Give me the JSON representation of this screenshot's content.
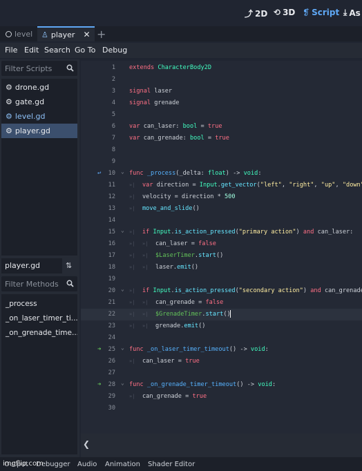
{
  "workspaces": [
    {
      "label": "2D",
      "icon": "2d-icon",
      "active": false
    },
    {
      "label": "3D",
      "icon": "3d-icon",
      "active": false
    },
    {
      "label": "Script",
      "icon": "script-icon",
      "active": true
    },
    {
      "label": "As",
      "icon": "assetlib-icon",
      "active": false
    }
  ],
  "tabs": [
    {
      "label": "level",
      "icon": "node-icon",
      "active": false
    },
    {
      "label": "player",
      "icon": "character-icon",
      "active": true
    }
  ],
  "add_tab_label": "+",
  "menu": [
    "File",
    "Edit",
    "Search",
    "Go To",
    "Debug"
  ],
  "scripts_filter_placeholder": "Filter Scripts",
  "scripts": [
    {
      "name": "drone.gd",
      "selected": false
    },
    {
      "name": "gate.gd",
      "selected": false
    },
    {
      "name": "level.gd",
      "selected": false
    },
    {
      "name": "player.gd",
      "selected": true
    }
  ],
  "current_script": "player.gd",
  "methods_filter_placeholder": "Filter Methods",
  "methods": [
    "_process",
    "_on_laser_timer_ti...",
    "_on_grenade_time..."
  ],
  "code_lines": [
    {
      "n": "1",
      "t": [
        [
          "kw",
          "extends "
        ],
        [
          "ty",
          "CharacterBody2D"
        ]
      ]
    },
    {
      "n": "2",
      "t": []
    },
    {
      "n": "3",
      "t": [
        [
          "kw",
          "signal "
        ],
        [
          "tx",
          "laser"
        ]
      ]
    },
    {
      "n": "4",
      "t": [
        [
          "kw",
          "signal "
        ],
        [
          "tx",
          "grenade"
        ]
      ]
    },
    {
      "n": "5",
      "t": []
    },
    {
      "n": "6",
      "t": [
        [
          "kw",
          "var "
        ],
        [
          "tx",
          "can_laser: "
        ],
        [
          "ty",
          "bool"
        ],
        [
          "tx",
          " = "
        ],
        [
          "kw",
          "true"
        ]
      ]
    },
    {
      "n": "7",
      "t": [
        [
          "kw",
          "var "
        ],
        [
          "tx",
          "can_grenade: "
        ],
        [
          "ty",
          "bool"
        ],
        [
          "tx",
          " = "
        ],
        [
          "kw",
          "true"
        ]
      ]
    },
    {
      "n": "8",
      "t": []
    },
    {
      "n": "9",
      "t": []
    },
    {
      "n": "10",
      "t": [
        [
          "kw",
          "func "
        ],
        [
          "fn",
          "_process"
        ],
        [
          "tx",
          "(_delta: "
        ],
        [
          "ty",
          "float"
        ],
        [
          "tx",
          ") -> "
        ],
        [
          "ty",
          "void"
        ],
        [
          "tx",
          ":"
        ]
      ],
      "fold": true,
      "gutter": "override"
    },
    {
      "n": "11",
      "t": [
        [
          "kw",
          "var "
        ],
        [
          "tx",
          "direction = "
        ],
        [
          "ty",
          "Input"
        ],
        [
          "tx",
          "."
        ],
        [
          "fc",
          "get_vector"
        ],
        [
          "tx",
          "("
        ],
        [
          "st",
          "\"left\""
        ],
        [
          "tx",
          ", "
        ],
        [
          "st",
          "\"right\""
        ],
        [
          "tx",
          ", "
        ],
        [
          "st",
          "\"up\""
        ],
        [
          "tx",
          ", "
        ],
        [
          "st",
          "\"down\""
        ],
        [
          "tx",
          ")"
        ]
      ],
      "indent": 1
    },
    {
      "n": "12",
      "t": [
        [
          "tx",
          "velocity = direction * "
        ],
        [
          "nm",
          "500"
        ]
      ],
      "indent": 1
    },
    {
      "n": "13",
      "t": [
        [
          "fc",
          "move_and_slide"
        ],
        [
          "tx",
          "()"
        ]
      ],
      "indent": 1
    },
    {
      "n": "14",
      "t": []
    },
    {
      "n": "15",
      "t": [
        [
          "kw",
          "if "
        ],
        [
          "ty",
          "Input"
        ],
        [
          "tx",
          "."
        ],
        [
          "fc",
          "is_action_pressed"
        ],
        [
          "tx",
          "("
        ],
        [
          "st",
          "\"primary action\""
        ],
        [
          "tx",
          ") "
        ],
        [
          "kw",
          "and "
        ],
        [
          "tx",
          "can_laser:"
        ]
      ],
      "indent": 1,
      "fold": true
    },
    {
      "n": "16",
      "t": [
        [
          "tx",
          "can_laser = "
        ],
        [
          "kw",
          "false"
        ]
      ],
      "indent": 2
    },
    {
      "n": "17",
      "t": [
        [
          "nd",
          "$LaserTimer"
        ],
        [
          "tx",
          "."
        ],
        [
          "fc",
          "start"
        ],
        [
          "tx",
          "()"
        ]
      ],
      "indent": 2
    },
    {
      "n": "18",
      "t": [
        [
          "tx",
          "laser."
        ],
        [
          "fc",
          "emit"
        ],
        [
          "tx",
          "()"
        ]
      ],
      "indent": 2
    },
    {
      "n": "19",
      "t": []
    },
    {
      "n": "20",
      "t": [
        [
          "kw",
          "if "
        ],
        [
          "ty",
          "Input"
        ],
        [
          "tx",
          "."
        ],
        [
          "fc",
          "is_action_pressed"
        ],
        [
          "tx",
          "("
        ],
        [
          "st",
          "\"secondary action\""
        ],
        [
          "tx",
          ") "
        ],
        [
          "kw",
          "and "
        ],
        [
          "tx",
          "can_grenade:"
        ]
      ],
      "indent": 1,
      "fold": true
    },
    {
      "n": "21",
      "t": [
        [
          "tx",
          "can_grenade = "
        ],
        [
          "kw",
          "false"
        ]
      ],
      "indent": 2
    },
    {
      "n": "22",
      "t": [
        [
          "nd",
          "$GrenadeTimer"
        ],
        [
          "tx",
          "."
        ],
        [
          "fc",
          "start"
        ],
        [
          "tx",
          "()"
        ]
      ],
      "indent": 2,
      "current": true
    },
    {
      "n": "23",
      "t": [
        [
          "tx",
          "grenade."
        ],
        [
          "fc",
          "emit"
        ],
        [
          "tx",
          "()"
        ]
      ],
      "indent": 2
    },
    {
      "n": "24",
      "t": []
    },
    {
      "n": "25",
      "t": [
        [
          "kw",
          "func "
        ],
        [
          "fn",
          "_on_laser_timer_timeout"
        ],
        [
          "tx",
          "() -> "
        ],
        [
          "ty",
          "void"
        ],
        [
          "tx",
          ":"
        ]
      ],
      "fold": true,
      "gutter": "signal"
    },
    {
      "n": "26",
      "t": [
        [
          "tx",
          "can_laser = "
        ],
        [
          "kw",
          "true"
        ]
      ],
      "indent": 1
    },
    {
      "n": "27",
      "t": []
    },
    {
      "n": "28",
      "t": [
        [
          "kw",
          "func "
        ],
        [
          "fn",
          "_on_grenade_timer_timeout"
        ],
        [
          "tx",
          "() -> "
        ],
        [
          "ty",
          "void"
        ],
        [
          "tx",
          ":"
        ]
      ],
      "fold": true,
      "gutter": "signal"
    },
    {
      "n": "29",
      "t": [
        [
          "tx",
          "can_grenade = "
        ],
        [
          "kw",
          "true"
        ]
      ],
      "indent": 1
    },
    {
      "n": "30",
      "t": []
    }
  ],
  "collapse_label": "❮",
  "bottom_tabs": [
    "Output",
    "Debugger",
    "Audio",
    "Animation",
    "Shader Editor"
  ],
  "watermark": "imgflip.com"
}
